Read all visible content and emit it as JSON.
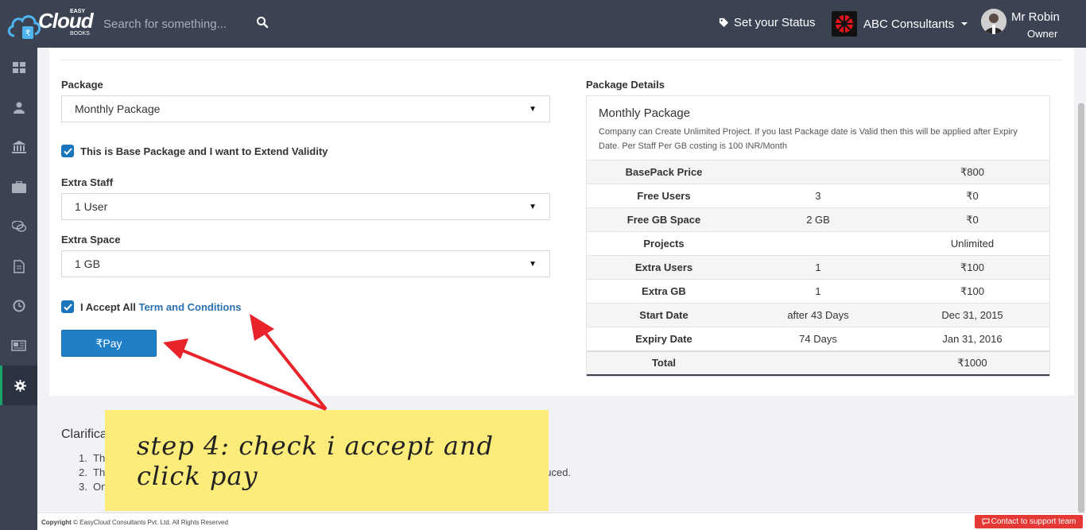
{
  "header": {
    "logo": {
      "brand": "Cloud",
      "top": "EASY",
      "bottom": "BOOKS"
    },
    "search_placeholder": "Search for something...",
    "status_label": "Set your Status",
    "company_name": "ABC Consultants",
    "user_name": "Mr Robin",
    "user_role": "Owner"
  },
  "sidebar": {
    "items": [
      {
        "icon": "dashboard-icon"
      },
      {
        "icon": "user-icon"
      },
      {
        "icon": "bank-icon"
      },
      {
        "icon": "briefcase-icon"
      },
      {
        "icon": "chat-icon"
      },
      {
        "icon": "document-icon"
      },
      {
        "icon": "clock-icon"
      },
      {
        "icon": "newspaper-icon"
      },
      {
        "icon": "gear-icon",
        "active": true
      }
    ]
  },
  "form": {
    "package_label": "Package",
    "package_value": "Monthly Package",
    "base_package_checkbox": "This is Base Package and I want to Extend Validity",
    "extra_staff_label": "Extra Staff",
    "extra_staff_value": "1 User",
    "extra_space_label": "Extra Space",
    "extra_space_value": "1 GB",
    "accept_prefix": "I Accept All",
    "accept_link": "Term and Conditions",
    "pay_label": "₹Pay"
  },
  "details": {
    "title": "Package Details",
    "package_name": "Monthly Package",
    "description": "Company can Create Unlimited Project. If you last Package date is Valid then this will be applied after Expiry Date. Per Staff Per GB costing is 100 INR/Month",
    "rows": [
      {
        "label": "BasePack Price",
        "qty": "",
        "value": "₹800"
      },
      {
        "label": "Free Users",
        "qty": "3",
        "value": "₹0"
      },
      {
        "label": "Free GB Space",
        "qty": "2 GB",
        "value": "₹0"
      },
      {
        "label": "Projects",
        "qty": "",
        "value": "Unlimited"
      },
      {
        "label": "Extra Users",
        "qty": "1",
        "value": "₹100"
      },
      {
        "label": "Extra GB",
        "qty": "1",
        "value": "₹100"
      },
      {
        "label": "Start Date",
        "qty": "after 43 Days",
        "value": "Dec 31, 2015"
      },
      {
        "label": "Expiry Date",
        "qty": "74 Days",
        "value": "Jan 31, 2016"
      }
    ],
    "total_label": "Total",
    "total_value": "₹1000"
  },
  "clarifications": {
    "title": "Clarifica",
    "items": [
      {
        "num": "1.",
        "text": "Th"
      },
      {
        "num": "2.",
        "text": "Th",
        "tail": "duced."
      },
      {
        "num": "3.",
        "text": "On"
      }
    ]
  },
  "note": "step 4: check i accept and click pay",
  "footer": {
    "copyright_bold": "Copyright",
    "copyright_text": "© EasyCloud Consultants Pvt. Ltd. All Rights Reserved",
    "support": "Contact to support team"
  },
  "colors": {
    "topbar": "#3b4353",
    "primary": "#1f80c8",
    "note": "#fdec7a",
    "arrow": "#e8232a",
    "sidebar_active": "#1aa26b"
  }
}
